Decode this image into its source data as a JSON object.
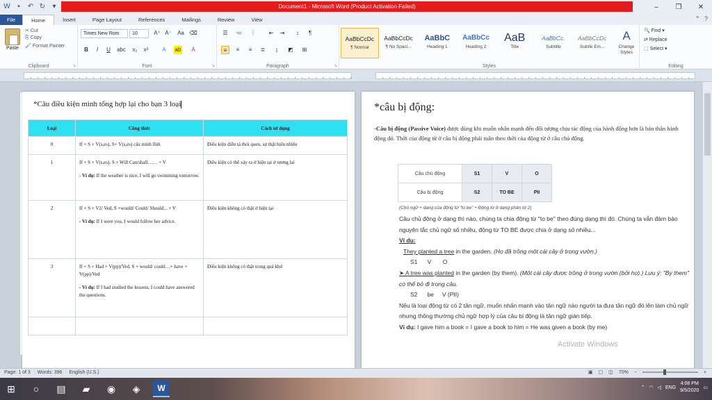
{
  "window": {
    "title": "Document1 - Microsoft Word (Product Activation Failed)"
  },
  "tabs": [
    "File",
    "Home",
    "Insert",
    "Page Layout",
    "References",
    "Mailings",
    "Review",
    "View"
  ],
  "ribbon": {
    "clipboard": {
      "label": "Clipboard",
      "paste": "Paste",
      "cut": "Cut",
      "copy": "Copy",
      "format_painter": "Format Painter"
    },
    "font": {
      "label": "Font",
      "name": "Times New Rom",
      "size": "10"
    },
    "paragraph": {
      "label": "Paragraph"
    },
    "styles": {
      "label": "Styles",
      "items": [
        {
          "preview": "AaBbCcDc",
          "name": "¶ Normal",
          "selected": true
        },
        {
          "preview": "AaBbCcDc",
          "name": "¶ No Spaci...",
          "selected": false
        },
        {
          "preview": "AaBbC",
          "name": "Heading 1",
          "selected": false
        },
        {
          "preview": "AaBbCc",
          "name": "Heading 2",
          "selected": false
        },
        {
          "preview": "AaB",
          "name": "Title",
          "selected": false
        },
        {
          "preview": "AaBbCc.",
          "name": "Subtitle",
          "selected": false
        },
        {
          "preview": "AaBbCcDc",
          "name": "Subtle Em...",
          "selected": false
        }
      ],
      "change_styles": "Change Styles"
    },
    "editing": {
      "label": "Editing",
      "find": "Find",
      "replace": "Replace",
      "select": "Select"
    }
  },
  "page1": {
    "heading": "*Câu điều kiện mình tổng hợp lại cho bạn 3 loại",
    "table": {
      "headers": [
        "Loại",
        "Công thức",
        "Cách sử dụng"
      ],
      "rows": [
        {
          "type": "0",
          "formula": "If + S + V(s,es), S+ V(s,es) câu mình lĩnh",
          "example_label": "",
          "example": "",
          "usage": "Điều kiện diễn tả thói quen, sự thật hiển nhiên"
        },
        {
          "type": "1",
          "formula": "If + S + V(s,es), S + Will Can/shall…… + V",
          "example_label": "- Ví dụ:",
          "example": "If the weather is nice, I will go swimming tomorrow.",
          "usage": "Điều kiện có thể xảy ra ở hiện tại ở tương lai"
        },
        {
          "type": "2",
          "formula": "If + S + V2/ Ved, S +would/ Could/ Should…+ V",
          "example_label": "- Ví dụ:",
          "example": "If I were you, I would follow her advice.",
          "usage": "Điều kiện không có thật ở hiện tại"
        },
        {
          "type": "3",
          "formula": "If + S + Had + V(pp)/Ved, S + would/ could…+ have + V(pp)/Ved",
          "example_label": "- Ví dụ:",
          "example": "If I had studied the lessons, I could have answered the questions.",
          "usage": "Điều kiện không có thật trong quá khứ"
        }
      ]
    }
  },
  "page2": {
    "heading": "*câu bị động:",
    "intro_lead": "-Câu bị động (Passive Voice)",
    "intro_rest": " được dùng khi muốn nhấn mạnh đến đối tượng chịu tác động của hành động hơn là bản thân hành động đó. Thời của động từ ở câu bị động phải tuân theo thời của động từ ở câu chủ động.",
    "pv_table": [
      [
        "Câu chủ động",
        "S1",
        "V",
        "O"
      ],
      [
        "Câu bị động",
        "S2",
        "TO BE",
        "PII"
      ]
    ],
    "note": "(Chủ ngữ + dạng của động từ \"to be\" + Động từ ở dạng phân từ 2)",
    "para1": "Câu chủ động ở dạng thì nào, chúng ta chia động từ \"to be\" theo đúng dạng thì đó. Chúng ta vẫn đảm bảo nguyên tắc chủ ngữ số nhiều, động từ TO BE được chia ở dạng số nhiều...",
    "example_heading": "Ví dụ:",
    "ex1_sentence": "They planted a tree",
    "ex1_rest": " in the garden.",
    "ex1_note": " (Họ đã trồng một cái cây ở trong vườn.)",
    "ex1_parts": "S1      V       O",
    "ex2_sentence": "➤ A tree was planted",
    "ex2_rest": " in the garden (by them).",
    "ex2_note": " (Một cái cây được trồng ở trong vườn (bởi họ).) Lưu ý: \"By them\" có thể bỏ đi trong câu.",
    "ex2_parts": "S2      be     V (PII)",
    "para2": "Nếu là loại động từ có 2 tân ngữ, muốn nhấn mạnh vào tân ngữ nào người ta đưa tân ngữ đó lên làm chủ ngữ nhưng thông thường chủ ngữ hợp lý của câu bị động là tân ngữ gián tiếp.",
    "ex3_label": "Ví dụ:",
    "ex3": " I gave him a book = I gave a book to him = He was given a book (by me)",
    "watermark": "Activate Windows"
  },
  "status": {
    "page": "Page: 1 of 3",
    "words": "Words: 396",
    "language": "English (U.S.)",
    "zoom": "70%"
  },
  "taskbar": {
    "language": "ENG",
    "time": "4:08 PM",
    "date": "9/5/2020"
  },
  "colors": {
    "title_bar_red": "#e41b1b",
    "table_header_cyan": "#2ee0f2",
    "word_blue": "#2b579a"
  }
}
